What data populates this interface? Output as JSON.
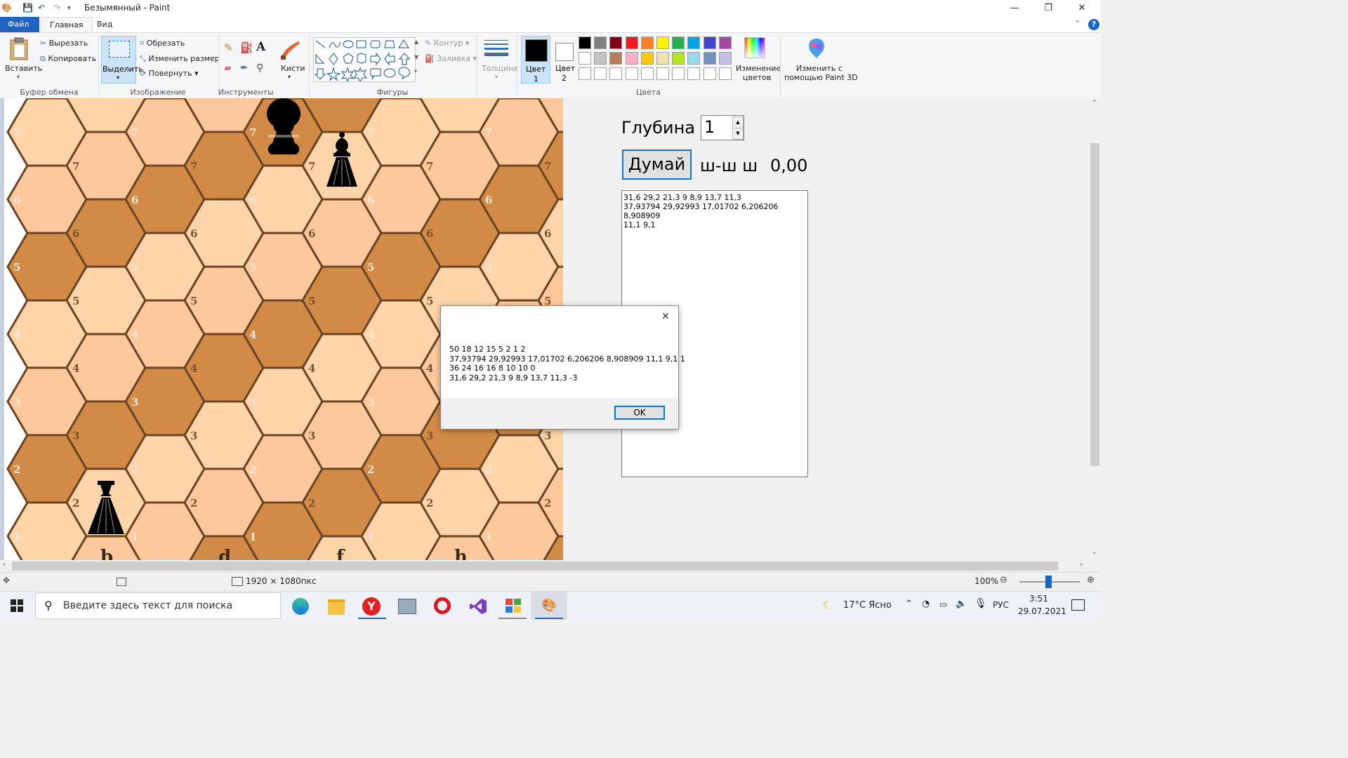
{
  "window": {
    "title": "Безымянный - Paint",
    "controls": {
      "minimize": "—",
      "restore": "❐",
      "close": "✕"
    }
  },
  "ribbon_tabs": {
    "file": "Файл",
    "home": "Главная",
    "view": "Вид"
  },
  "clipboard": {
    "paste": "Вставить",
    "cut": "Вырезать",
    "copy": "Копировать",
    "group": "Буфер обмена"
  },
  "image": {
    "select": "Выделить",
    "crop": "Обрезать",
    "resize": "Изменить размер",
    "rotate": "Повернуть",
    "group": "Изображение"
  },
  "tools": {
    "group": "Инструменты",
    "brushes": "Кисти"
  },
  "shapes": {
    "group": "Фигуры",
    "outline": "Контур",
    "fill": "Заливка"
  },
  "size": {
    "label": "Толщина"
  },
  "colors": {
    "color1": "Цвет 1",
    "color1_a": "Цвет",
    "color1_b": "1",
    "color2_a": "Цвет",
    "color2_b": "2",
    "edit": "Изменение цветов",
    "edit_a": "Изменение",
    "edit_b": "цветов",
    "group": "Цвета",
    "paint3d_a": "Изменить с",
    "paint3d_b": "помощью Paint 3D",
    "palette_row1": [
      "#000000",
      "#7f7f7f",
      "#880015",
      "#ed1c24",
      "#ff7f27",
      "#fff200",
      "#22b14c",
      "#00a2e8",
      "#3f48cc",
      "#a349a4"
    ],
    "palette_row2": [
      "#ffffff",
      "#c3c3c3",
      "#b97a57",
      "#ffaec9",
      "#ffc90e",
      "#efe4b0",
      "#b5e61d",
      "#99d9ea",
      "#7092be",
      "#c8bfe7"
    ],
    "active_color": "#000000"
  },
  "board": {
    "ranks_visible": [
      "7",
      "6",
      "5",
      "4",
      "3",
      "2",
      "1"
    ],
    "files_visible": [
      "b",
      "d",
      "f",
      "h"
    ],
    "light_color": "#fdc99c",
    "medium_color": "#fdd5a9",
    "dark_color": "#d18b47",
    "pieces": [
      {
        "type": "queen",
        "color": "black"
      },
      {
        "type": "bishop",
        "color": "black"
      },
      {
        "type": "pawn",
        "color": "black"
      }
    ]
  },
  "panel": {
    "depth_label": "Глубина",
    "depth_value": "1",
    "think_button": "Думай",
    "status_text": "ш-ш ш",
    "score": "0,00",
    "log_lines": [
      "31,6 29,2 21,3 9 8,9 13,7 11,3",
      "37,93794 29,92993 17,01702 6,206206 8,908909",
      "11,1 9,1"
    ]
  },
  "dialog": {
    "lines": [
      "50 18 12 15 5 2 1 2",
      "37,93794 29,92993 17,01702 6,206206 8,908909 11,1 9,1 1",
      "36 24 16 16 8 10 10 0",
      "31,6 29,2 21,3 9 8,9 13,7 11,3 -3"
    ],
    "ok": "OK"
  },
  "statusbar": {
    "image_size": "1920 × 1080пкс",
    "zoom": "100%"
  },
  "taskbar": {
    "search_placeholder": "Введите здесь текст для поиска",
    "weather": "17°C Ясно",
    "lang": "РУС",
    "time": "3:51",
    "date": "29.07.2021"
  }
}
